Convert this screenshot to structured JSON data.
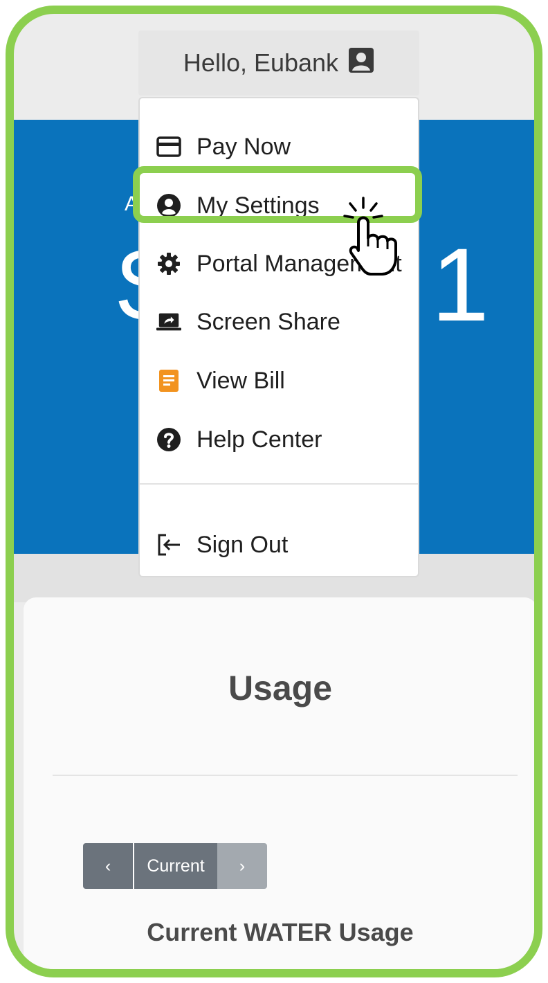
{
  "header": {
    "greeting": "Hello, Eubank",
    "user_icon": "user-square-icon"
  },
  "banner": {
    "label_partial": "A",
    "amount_partial": "$",
    "amount_tail": "1",
    "color": "#0a73bc"
  },
  "menu": {
    "items": [
      {
        "label": "Pay Now",
        "icon": "credit-card-icon"
      },
      {
        "label": "My Settings",
        "icon": "user-circle-icon"
      },
      {
        "label": "Portal Management",
        "icon": "gear-icon"
      },
      {
        "label": "Screen Share",
        "icon": "screen-share-icon"
      },
      {
        "label": "View Bill",
        "icon": "bill-document-icon",
        "icon_color": "#f2931f"
      },
      {
        "label": "Help Center",
        "icon": "question-circle-icon"
      }
    ],
    "sign_out": {
      "label": "Sign Out",
      "icon": "sign-out-icon"
    },
    "highlighted_item": "My Settings",
    "highlight_color": "#8ccf4f"
  },
  "usage": {
    "title": "Usage",
    "pager": {
      "prev_label": "‹",
      "current_label": "Current",
      "next_label": "›"
    },
    "footer_title": "Current WATER Usage"
  }
}
